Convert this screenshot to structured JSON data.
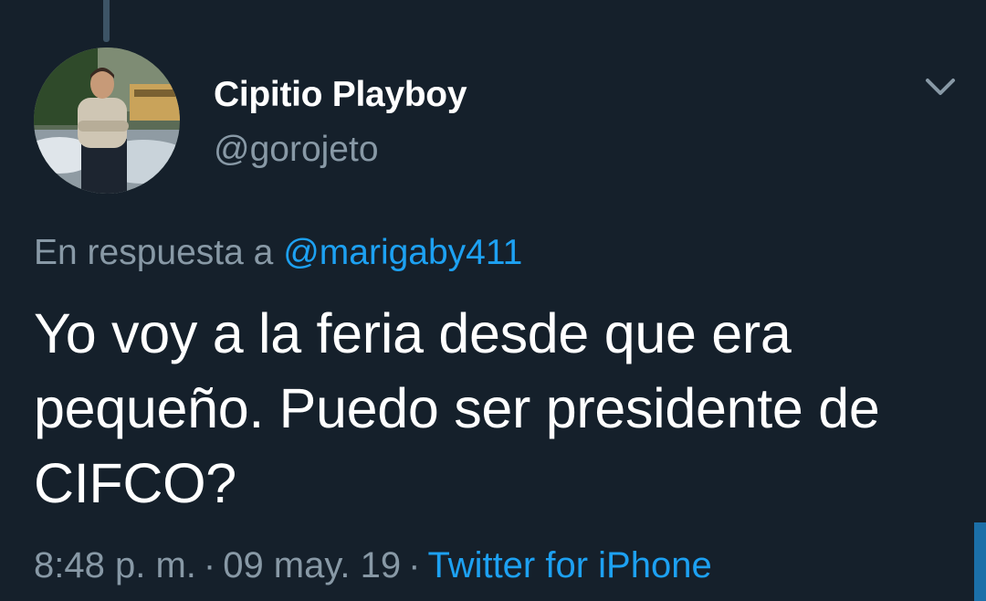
{
  "tweet": {
    "display_name": "Cipitio Playboy",
    "handle": "@gorojeto",
    "reply_prefix": "En respuesta a",
    "reply_to": "@marigaby411",
    "text": "Yo voy a la feria desde que era pequeño. Puedo ser presidente de CIFCO?",
    "time": "8:48 p. m.",
    "separator": "·",
    "date": "09 may. 19",
    "source": "Twitter for iPhone"
  },
  "icons": {
    "menu_caret": "chevron-down-icon"
  },
  "colors": {
    "background": "#15202b",
    "primary_text": "#ffffff",
    "secondary_text": "#8899a6",
    "accent": "#1da1f2"
  }
}
